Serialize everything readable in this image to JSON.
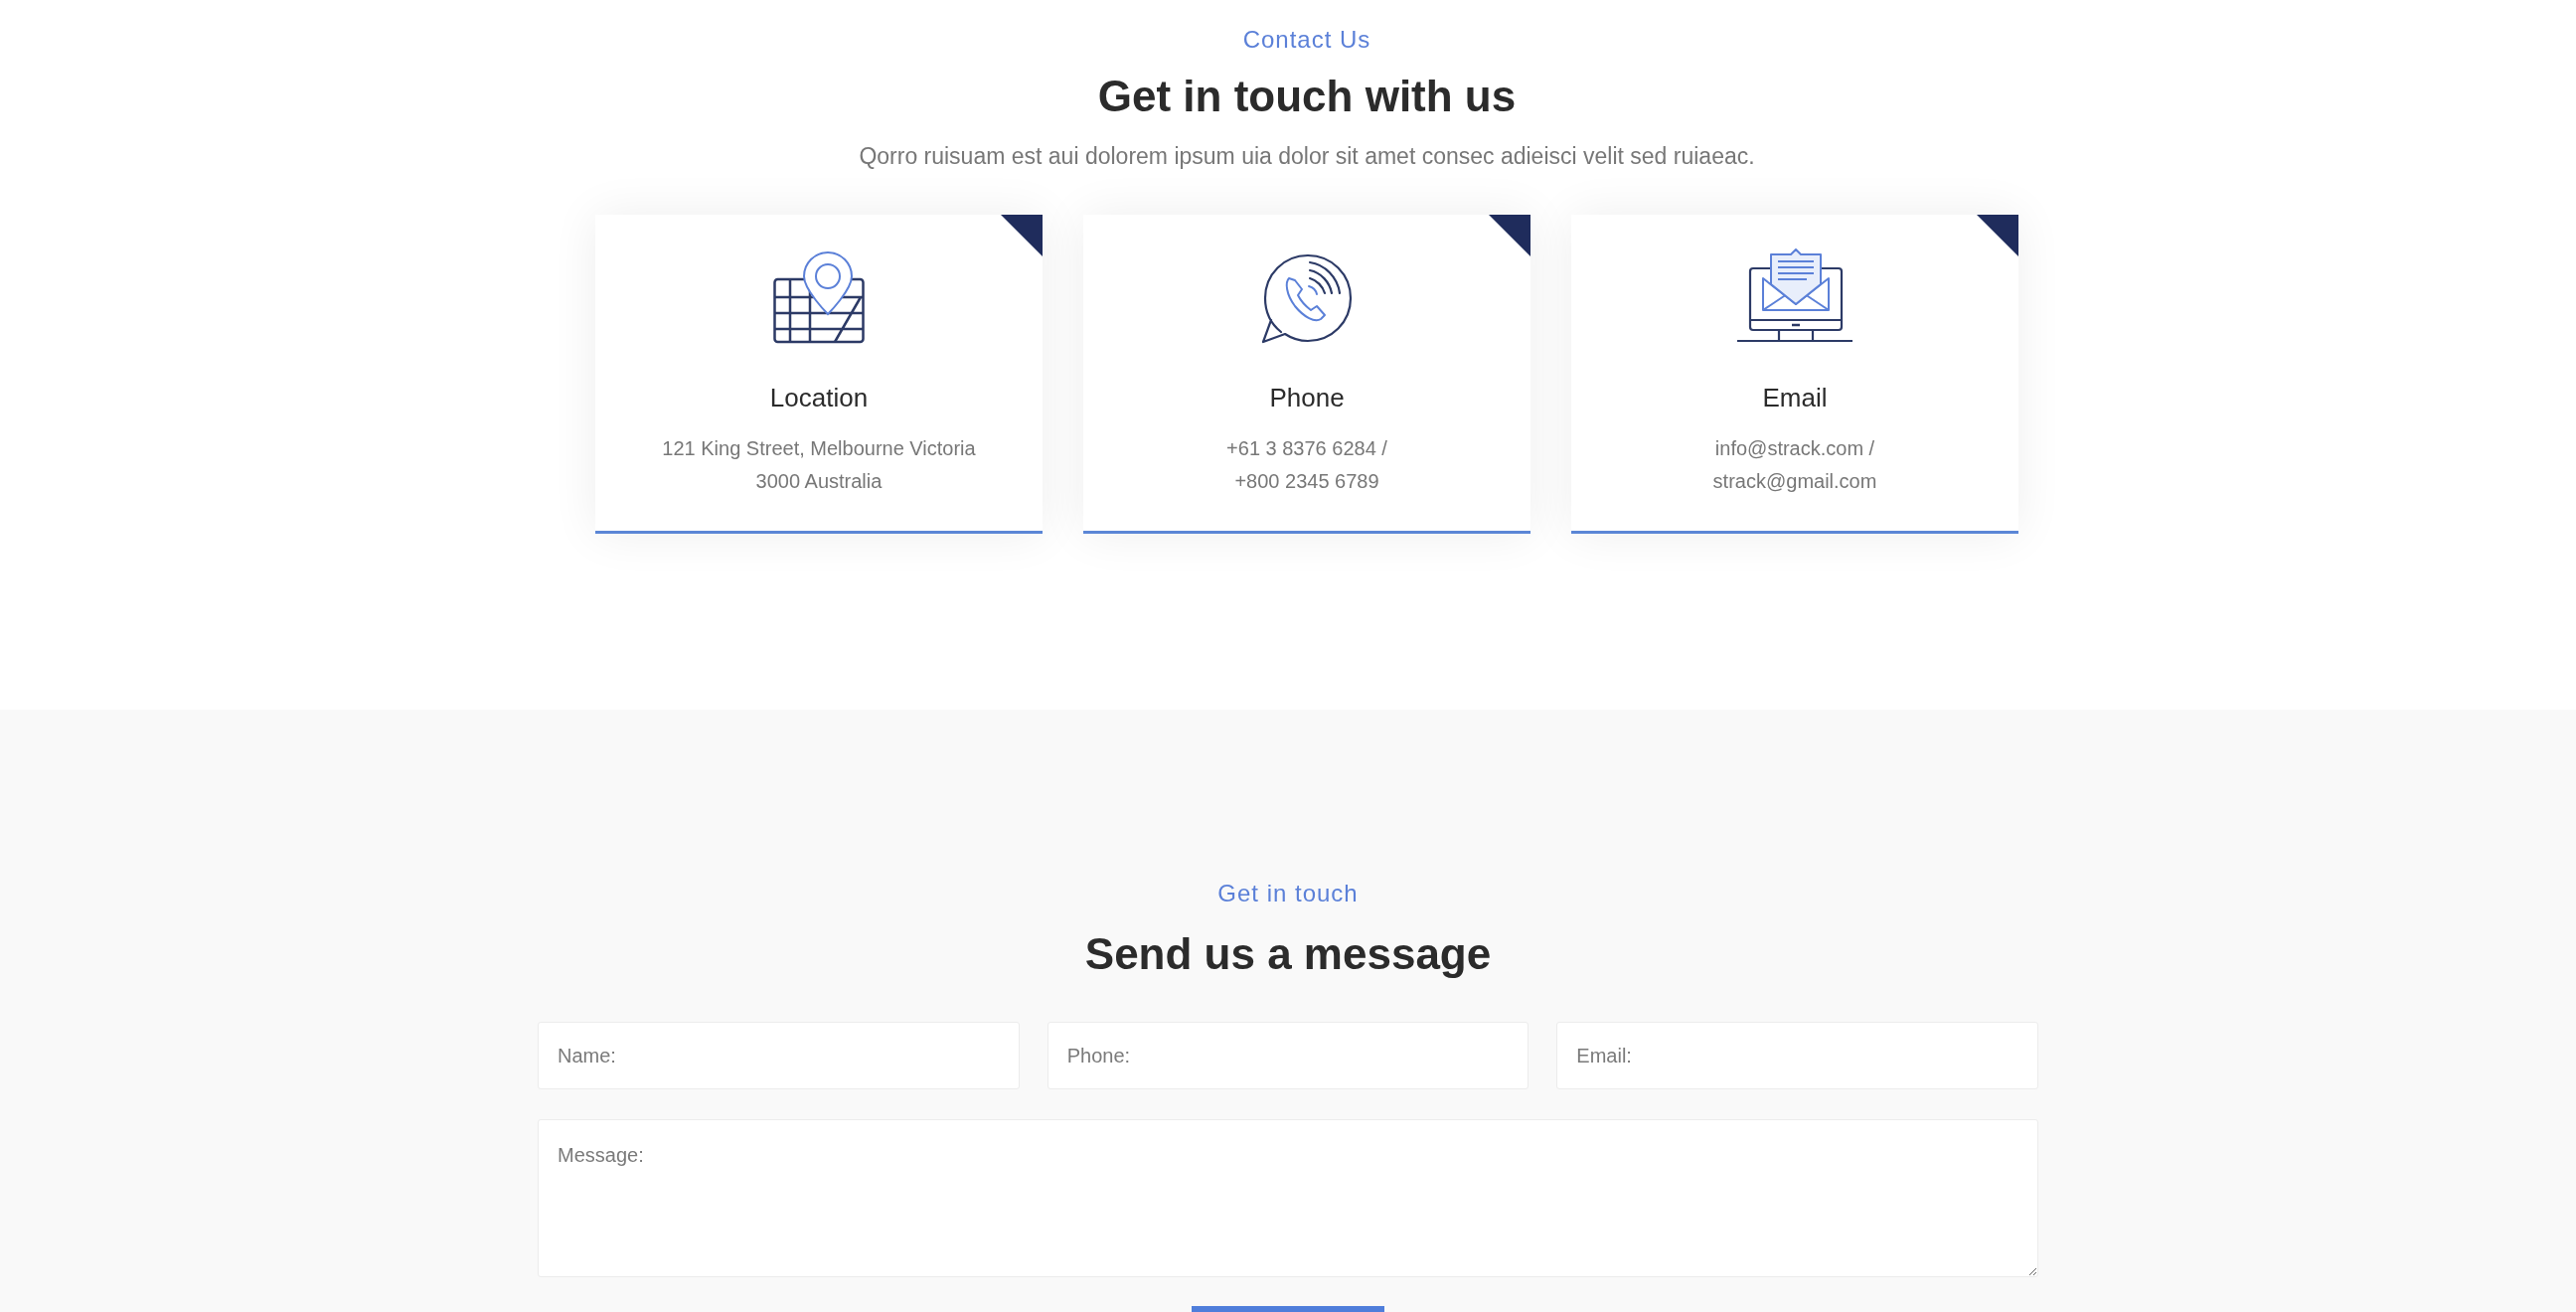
{
  "contact_section": {
    "eyebrow": "Contact Us",
    "title": "Get in touch with us",
    "subtitle": "Qorro ruisuam est aui dolorem ipsum uia dolor sit amet consec adieisci velit sed ruiaeac.",
    "cards": [
      {
        "kind": "location",
        "title": "Location",
        "lines": [
          "121 King Street, Melbourne Victoria",
          "3000 Australia"
        ]
      },
      {
        "kind": "phone",
        "title": "Phone",
        "lines": [
          "+61 3 8376 6284 /",
          "+800 2345 6789"
        ]
      },
      {
        "kind": "email",
        "title": "Email",
        "lines": [
          "info@strack.com /",
          "strack@gmail.com"
        ]
      }
    ]
  },
  "message_section": {
    "eyebrow": "Get in touch",
    "title": "Send us a message",
    "fields": [
      {
        "placeholder": "Name:"
      },
      {
        "placeholder": "Phone:"
      },
      {
        "placeholder": "Email:"
      }
    ],
    "message": {
      "placeholder": "Message:"
    },
    "submit_button": {
      "kind": "primary"
    }
  }
}
